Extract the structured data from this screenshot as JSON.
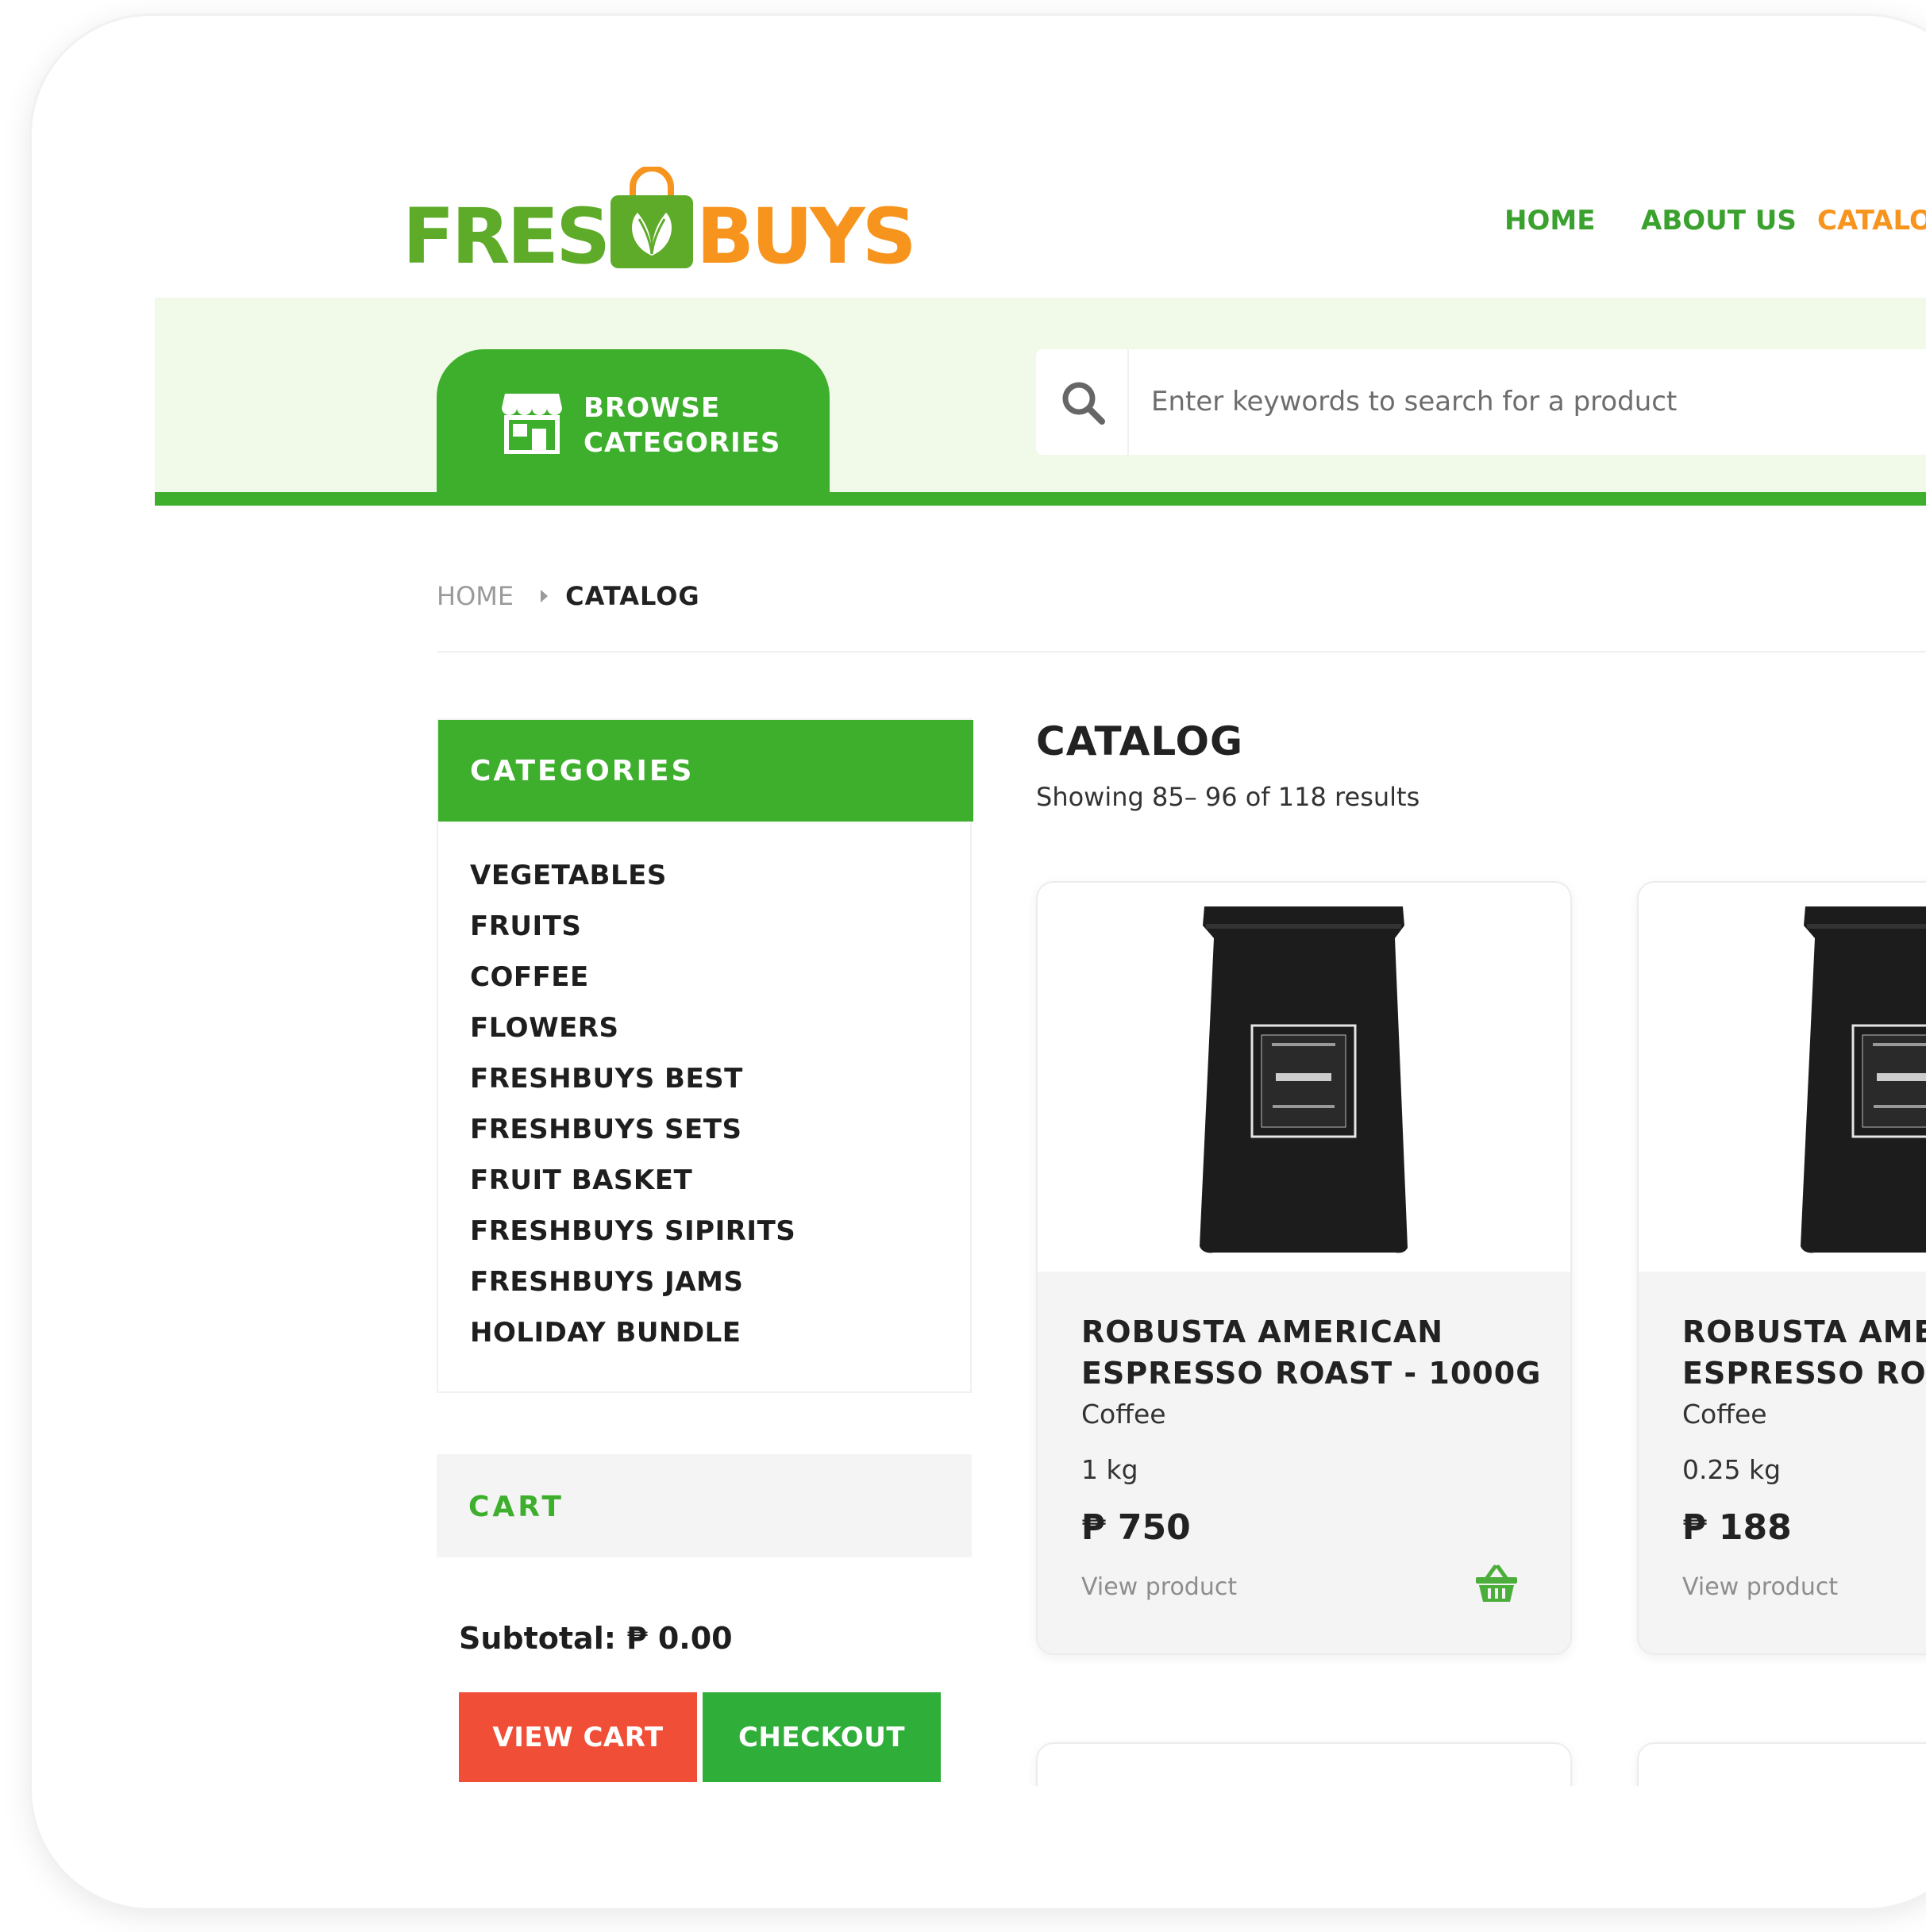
{
  "logo": {
    "part1": "FRESH",
    "part2": "BUYS"
  },
  "nav": [
    "HOME",
    "ABOUT US",
    "CATALOG"
  ],
  "browse": {
    "line1": "BROWSE",
    "line2": "CATEGORIES",
    "icon": "store-icon"
  },
  "search": {
    "placeholder": "Enter keywords to search for a product",
    "icon": "search-icon"
  },
  "breadcrumb": {
    "home": "HOME",
    "current": "CATALOG"
  },
  "categories": {
    "title": "CATEGORIES",
    "items": [
      "VEGETABLES",
      "FRUITS",
      "COFFEE",
      "FLOWERS",
      "FRESHBUYS BEST",
      "FRESHBUYS SETS",
      "FRUIT BASKET",
      "FRESHBUYS SIPIRITS",
      "FRESHBUYS JAMS",
      "HOLIDAY BUNDLE"
    ]
  },
  "cart": {
    "title": "CART",
    "subtotal": "Subtotal: ₱ 0.00",
    "view_cart": "VIEW CART",
    "checkout": "CHECKOUT"
  },
  "catalog": {
    "title": "CATALOG",
    "results": "Showing 85– 96 of 118 results"
  },
  "products": [
    {
      "name": "ROBUSTA AMERICAN ESPRESSO ROAST - 1000G",
      "type": "Coffee",
      "weight": "1 kg",
      "price": "₱ 750",
      "view": "View product"
    },
    {
      "name": "ROBUSTA AMERICAN ESPRESSO ROAST",
      "type": "Coffee",
      "weight": "0.25 kg",
      "price": "₱ 188",
      "view": "View product"
    }
  ],
  "colors": {
    "green": "#3daf2c",
    "orange": "#f7941d",
    "red": "#f04e37"
  }
}
